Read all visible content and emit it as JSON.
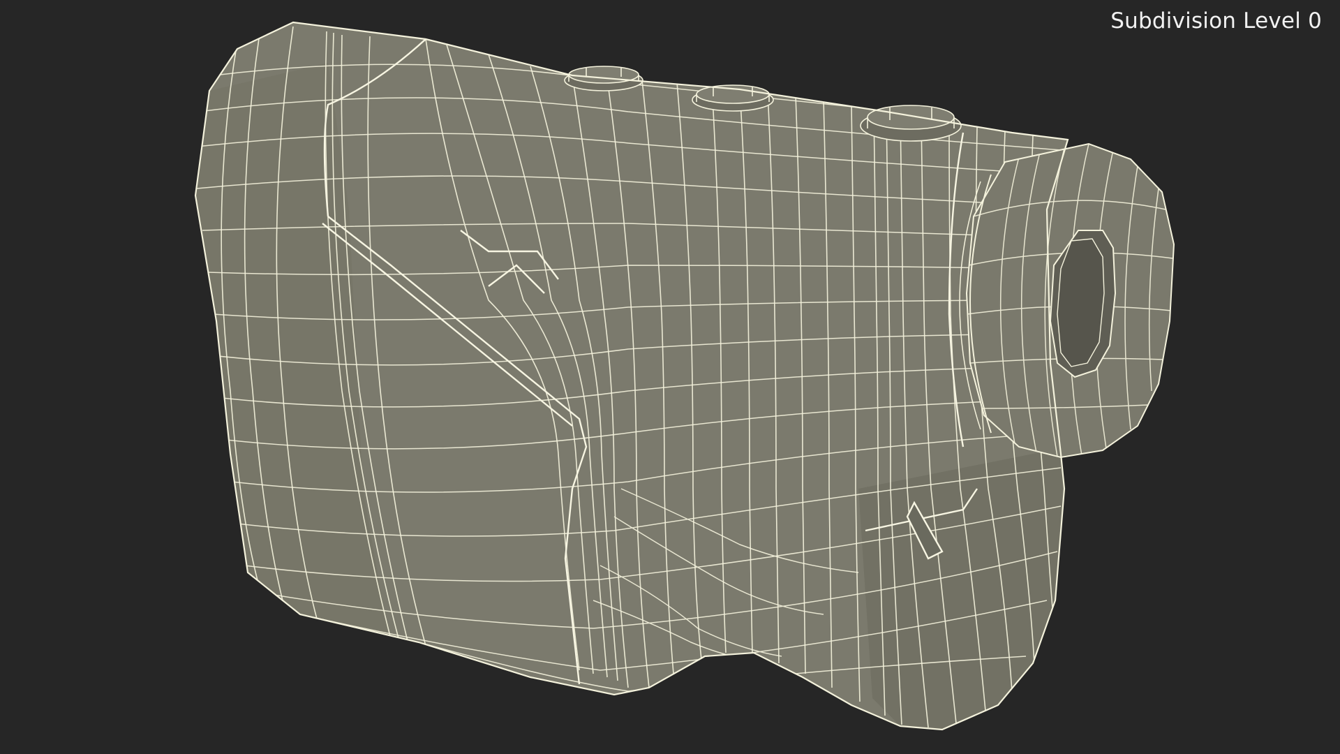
{
  "viewport": {
    "background_color": "#262626",
    "overlay_label": "Subdivision Level 0"
  },
  "model": {
    "name": "rangefinder-wireframe-render",
    "surface_color": "#7c7b6e",
    "surface_shade_color": "#6e6d61",
    "wire_color": "#f4f2dc"
  }
}
